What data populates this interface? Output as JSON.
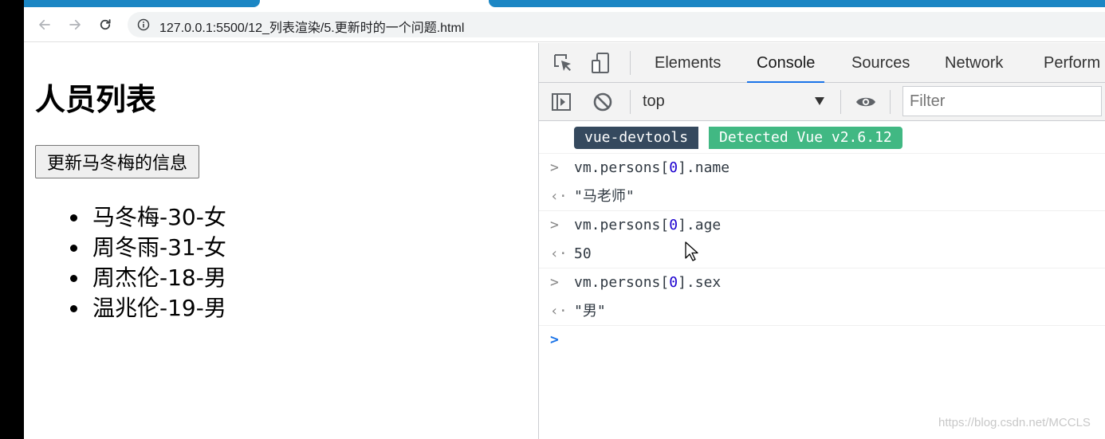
{
  "browser": {
    "url": "127.0.0.1:5500/12_列表渲染/5.更新时的一个问题.html"
  },
  "page": {
    "title": "人员列表",
    "button_label": "更新马冬梅的信息",
    "persons": [
      "马冬梅-30-女",
      "周冬雨-31-女",
      "周杰伦-18-男",
      "温兆伦-19-男"
    ]
  },
  "devtools": {
    "tabs": [
      "Elements",
      "Console",
      "Sources",
      "Network",
      "Perform"
    ],
    "active_tab": "Console",
    "context": "top",
    "filter_placeholder": "Filter",
    "badge_left": "vue-devtools",
    "badge_right": "Detected Vue v2.6.12",
    "badge_left_color": "#35495e",
    "badge_right_color": "#41b883",
    "entries": [
      {
        "prefix": "vm.persons[",
        "index": "0",
        "suffix": "].name",
        "result": "\"马老师\"",
        "result_type": "string"
      },
      {
        "prefix": "vm.persons[",
        "index": "0",
        "suffix": "].age",
        "result": "50",
        "result_type": "number"
      },
      {
        "prefix": "vm.persons[",
        "index": "0",
        "suffix": "].sex",
        "result": "\"男\"",
        "result_type": "string"
      }
    ]
  },
  "watermark": "https://blog.csdn.net/MCCLS"
}
